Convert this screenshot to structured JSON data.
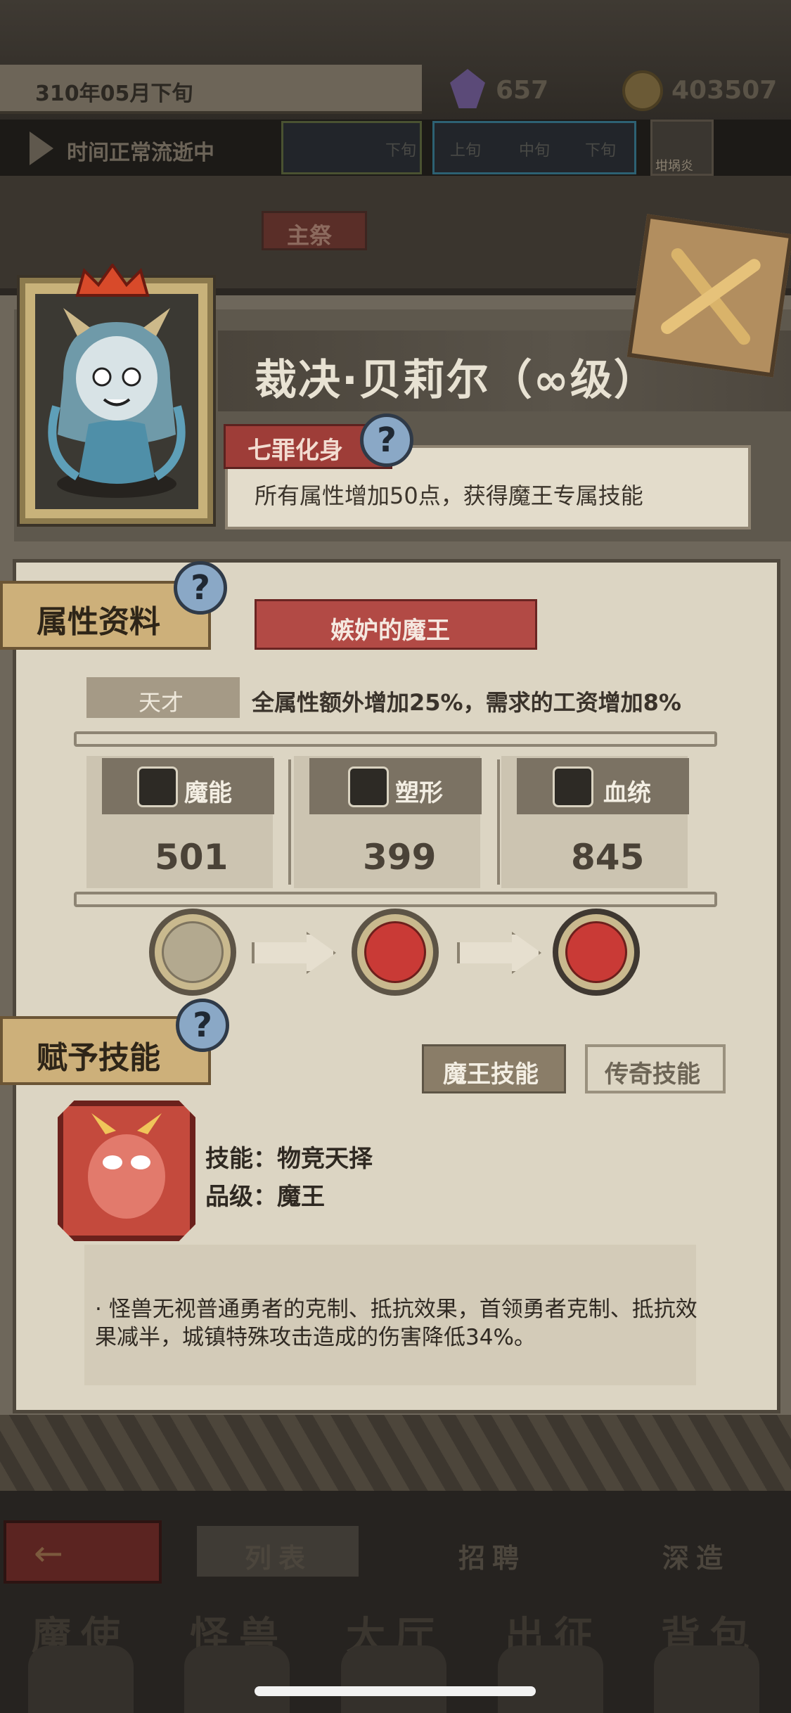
{
  "status_bar": {
    "date": "310年05月下旬",
    "crystals": "657",
    "gold": "403507",
    "time_status": "时间正常流逝中",
    "segments_left": [
      "",
      "下旬"
    ],
    "segments_right": [
      "上旬",
      "中旬",
      "下旬"
    ],
    "shop_label": "坩埚炎"
  },
  "background": {
    "main_rite": "主祭"
  },
  "character": {
    "name": "裁决·贝莉尔（∞级）",
    "title_tag": "七罪化身",
    "title_desc": "所有属性增加50点，获得魔王专属技能"
  },
  "attributes": {
    "section_title": "属性资料",
    "banner": "嫉妒的魔王",
    "trait_tag": "天才",
    "trait_desc": "全属性额外增加25%，需求的工资增加8%",
    "stats": [
      {
        "label": "魔能",
        "value": "501",
        "icon": "fist-icon"
      },
      {
        "label": "塑形",
        "value": "399",
        "icon": "body-icon"
      },
      {
        "label": "血统",
        "value": "845",
        "icon": "gear-icon"
      }
    ]
  },
  "skills": {
    "section_title": "赋予技能",
    "tab_active": "魔王技能",
    "tab_idle": "传奇技能",
    "skill_name_line": "技能：物竞天择",
    "skill_rank_line": "品级：魔王",
    "effect": "·   怪兽无视普通勇者的克制、抵抗效果，首领勇者克制、抵抗效果减半，城镇特殊攻击造成的伤害降低34%。"
  },
  "bottom_nav": {
    "tabs": [
      "列表",
      "招聘",
      "深造"
    ],
    "main": [
      "魔使",
      "怪兽",
      "大厅",
      "出征",
      "背包"
    ]
  },
  "colors": {
    "accent_red": "#b24a45",
    "parchment": "#dcd5c3",
    "badge_blue": "#8aa8c6"
  }
}
